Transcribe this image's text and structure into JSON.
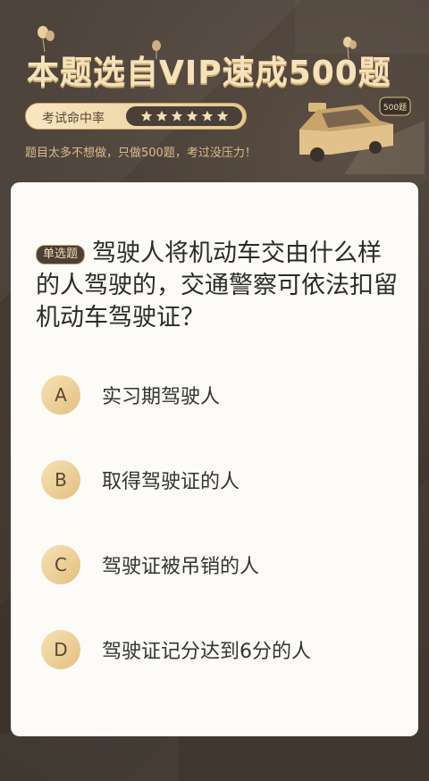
{
  "header": {
    "title": "本题选自VIP速成500题",
    "rate_label": "考试命中率",
    "star_count": 6,
    "subtitle": "题目太多不想做，只做500题，考过没压力！",
    "car_badge": "500题",
    "colors": {
      "gold": "#e3c07f",
      "dark": "#4a4038"
    }
  },
  "question": {
    "type_label": "单选题",
    "text": "驾驶人将机动车交由什么样的人驾驶的，交通警察可依法扣留机动车驾驶证？",
    "options": [
      {
        "letter": "A",
        "text": "实习期驾驶人"
      },
      {
        "letter": "B",
        "text": "取得驾驶证的人"
      },
      {
        "letter": "C",
        "text": "驾驶证被吊销的人"
      },
      {
        "letter": "D",
        "text": "驾驶证记分达到6分的人"
      }
    ]
  }
}
